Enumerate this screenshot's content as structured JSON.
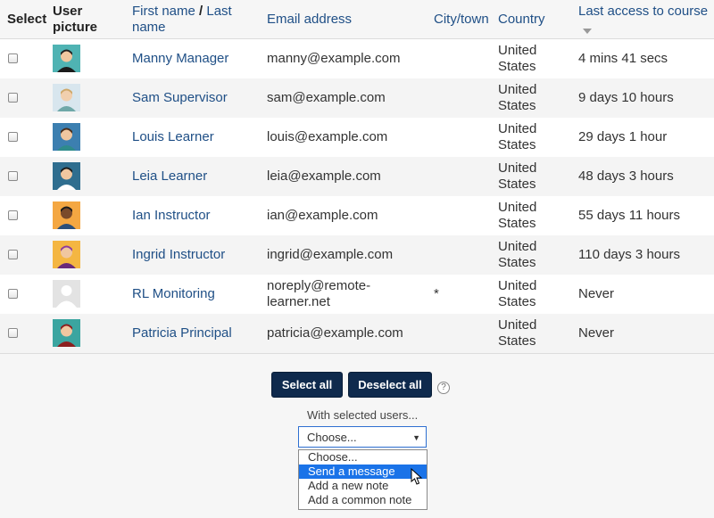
{
  "columns": {
    "select": "Select",
    "user_picture": "User picture",
    "first_name": "First name",
    "name_sep": "/",
    "last_name": "Last name",
    "email": "Email address",
    "city": "City/town",
    "country": "Country",
    "last_access": "Last access to course"
  },
  "rows": [
    {
      "name": "Manny Manager",
      "email": "manny@example.com",
      "city": "",
      "country": "United States",
      "last": "4 mins 41 secs",
      "avatar": "manager-avatar-icon"
    },
    {
      "name": "Sam Supervisor",
      "email": "sam@example.com",
      "city": "",
      "country": "United States",
      "last": "9 days 10 hours",
      "avatar": "supervisor-avatar-icon"
    },
    {
      "name": "Louis Learner",
      "email": "louis@example.com",
      "city": "",
      "country": "United States",
      "last": "29 days 1 hour",
      "avatar": "learner-avatar-icon"
    },
    {
      "name": "Leia Learner",
      "email": "leia@example.com",
      "city": "",
      "country": "United States",
      "last": "48 days 3 hours",
      "avatar": "learner-female-avatar-icon"
    },
    {
      "name": "Ian Instructor",
      "email": "ian@example.com",
      "city": "",
      "country": "United States",
      "last": "55 days 11 hours",
      "avatar": "instructor-avatar-icon"
    },
    {
      "name": "Ingrid Instructor",
      "email": "ingrid@example.com",
      "city": "",
      "country": "United States",
      "last": "110 days 3 hours",
      "avatar": "instructor-female-avatar-icon"
    },
    {
      "name": "RL Monitoring",
      "email": "noreply@remote-learner.net",
      "city": "*",
      "country": "United States",
      "last": "Never",
      "avatar": "default-user-avatar-icon"
    },
    {
      "name": "Patricia Principal",
      "email": "patricia@example.com",
      "city": "",
      "country": "United States",
      "last": "Never",
      "avatar": "principal-avatar-icon"
    }
  ],
  "actions": {
    "select_all": "Select all",
    "deselect_all": "Deselect all",
    "help": "?",
    "with_selected": "With selected users...",
    "dropdown_value": "Choose...",
    "dropdown_arrow": "▼",
    "options": [
      "Choose...",
      "Send a message",
      "Add a new note",
      "Add a common note"
    ],
    "highlighted_option": "Send a message"
  },
  "colors": {
    "link": "#1f4f86",
    "button_bg": "#0f2a4d",
    "highlight": "#1a73e8"
  }
}
